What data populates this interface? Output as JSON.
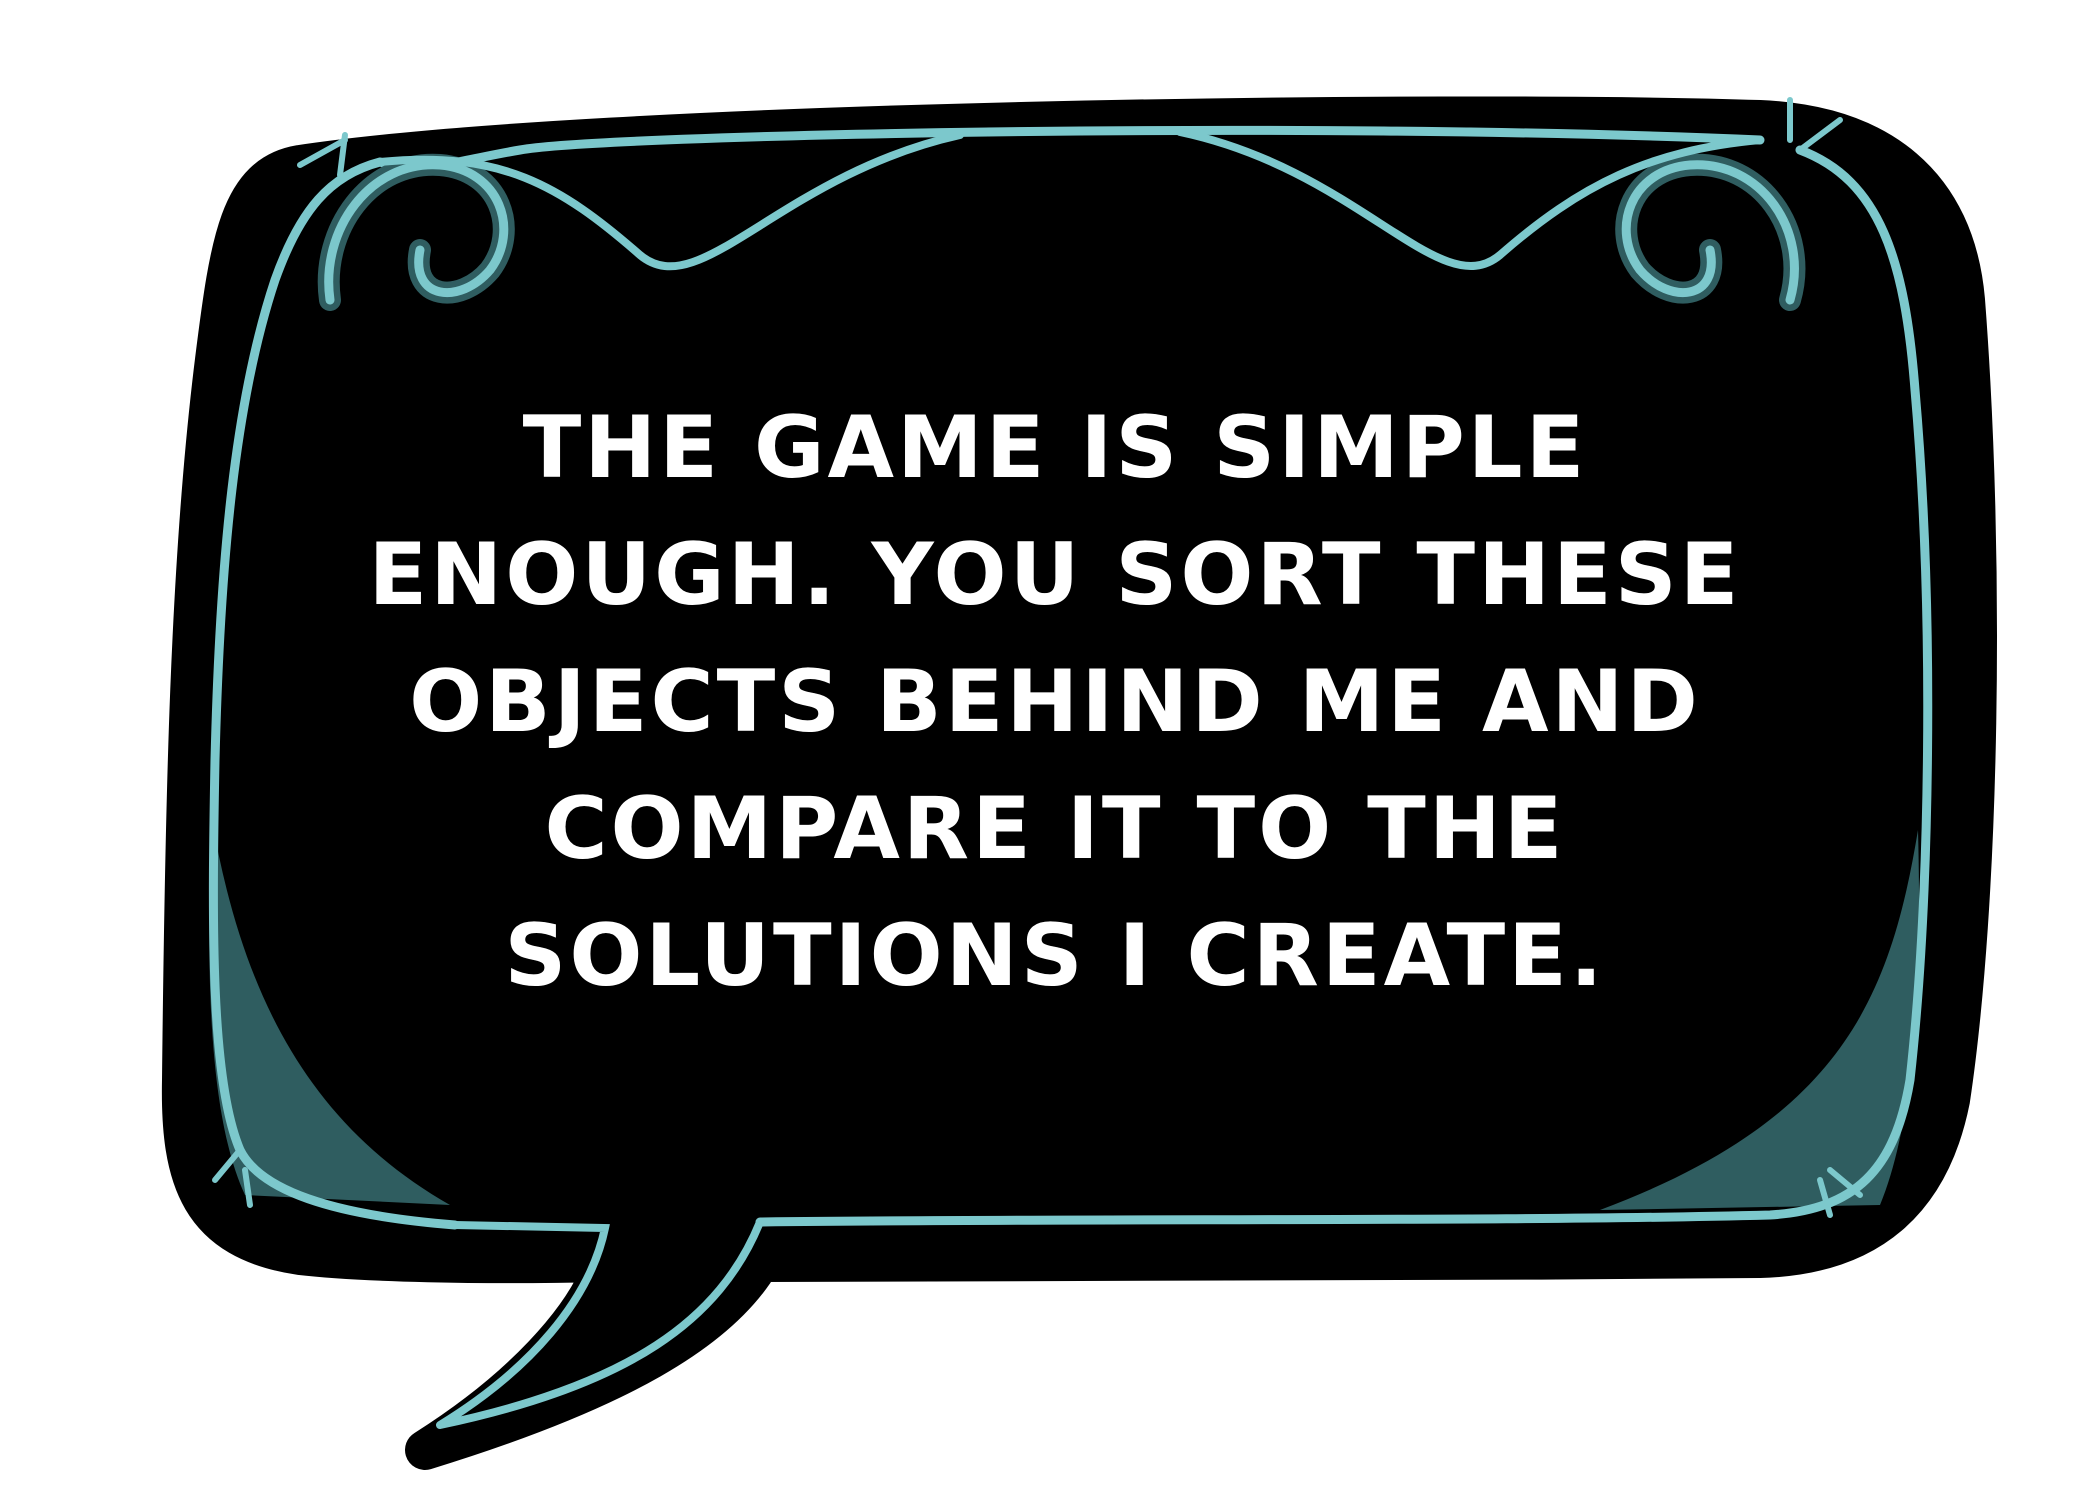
{
  "speech_bubble": {
    "lines": [
      "THE GAME IS SIMPLE",
      "ENOUGH. YOU SORT THESE",
      "OBJECTS BEHIND ME AND",
      "COMPARE IT TO THE",
      "SOLUTIONS I CREATE."
    ]
  },
  "colors": {
    "bubble_fill": "#000000",
    "frame_outline": "#7cc8cc",
    "frame_shadow": "#2f5d60",
    "text": "#ffffff",
    "background": "#ffffff"
  }
}
